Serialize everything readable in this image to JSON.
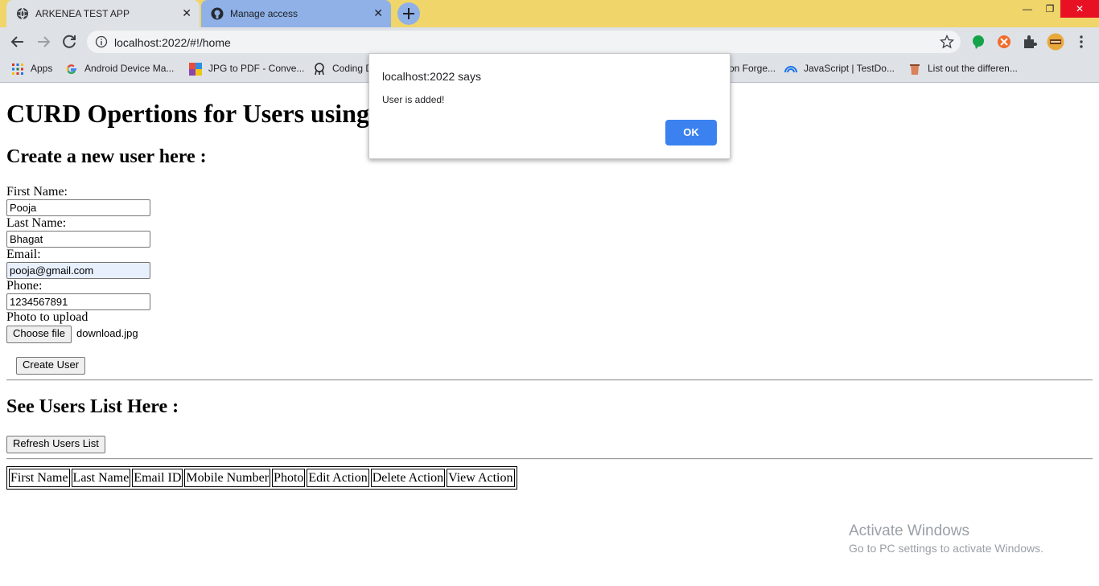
{
  "browser": {
    "tabs": [
      {
        "title": "ARKENEA TEST APP",
        "favicon": "globe-icon",
        "active": true
      },
      {
        "title": "Manage access",
        "favicon": "github-icon",
        "active": false
      }
    ],
    "close_glyph": "✕",
    "newtab_glyph": "+",
    "window_controls": {
      "minimize": "—",
      "restore": "❐",
      "close": "✕"
    },
    "url": "localhost:2022/#!/home",
    "bookmarks": [
      {
        "label": "Apps",
        "icon": "apps-grid-icon"
      },
      {
        "label": "Android Device Ma...",
        "icon": "google-icon"
      },
      {
        "label": "JPG to PDF - Conve...",
        "icon": "jpg-pdf-icon"
      },
      {
        "label": "Coding D",
        "icon": "coding-icon"
      },
      {
        "label": "on Forge...",
        "icon": "page-icon"
      },
      {
        "label": "JavaScript | TestDo...",
        "icon": "testdome-icon"
      },
      {
        "label": "List out the differen...",
        "icon": "cup-icon"
      }
    ]
  },
  "page": {
    "title": "CURD Opertions for Users using",
    "create_heading": "Create a new user here :",
    "form": {
      "first_name_label": "First Name:",
      "first_name_value": "Pooja",
      "last_name_label": "Last Name:",
      "last_name_value": "Bhagat",
      "email_label": "Email:",
      "email_value": "pooja@gmail.com",
      "phone_label": "Phone:",
      "phone_value": "1234567891",
      "photo_label": "Photo to upload",
      "choose_file_label": "Choose file",
      "file_name": "download.jpg",
      "create_button": "Create User"
    },
    "list_heading": "See Users List Here :",
    "refresh_button": "Refresh Users List",
    "table_headers": [
      "First Name",
      "Last Name",
      "Email ID",
      "Mobile Number",
      "Photo",
      "Edit Action",
      "Delete Action",
      "View Action"
    ]
  },
  "dialog": {
    "title": "localhost:2022 says",
    "message": "User is added!",
    "ok_button": "OK",
    "ok_color": "#3b82f0"
  },
  "watermark": {
    "line1": "Activate Windows",
    "line2": "Go to PC settings to activate Windows."
  }
}
